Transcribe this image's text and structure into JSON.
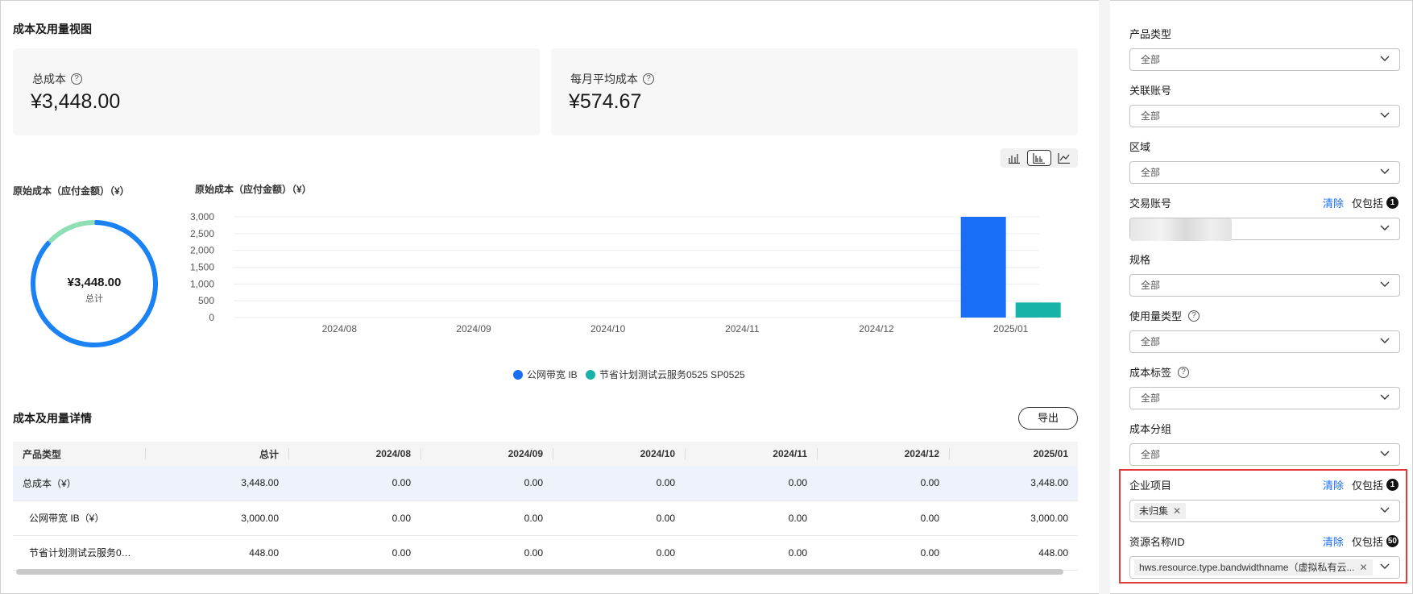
{
  "overview": {
    "title": "成本及用量视图",
    "total_cost_label": "总成本",
    "total_cost_value": "¥3,448.00",
    "monthly_avg_label": "每月平均成本",
    "monthly_avg_value": "¥574.67"
  },
  "view_switch": {
    "options": [
      "stacked-bar-icon",
      "grouped-bar-icon",
      "line-chart-icon"
    ],
    "active": 1
  },
  "ring": {
    "title": "原始成本（应付金额）（¥）",
    "center_value": "¥3,448.00",
    "center_label": "总计"
  },
  "chart_data": {
    "type": "bar",
    "title": "原始成本（应付金额）（¥）",
    "categories": [
      "2024/08",
      "2024/09",
      "2024/10",
      "2024/11",
      "2024/12",
      "2025/01"
    ],
    "series": [
      {
        "name": "公网带宽 IB",
        "color": "#1a6ef5",
        "values": [
          0,
          0,
          0,
          0,
          0,
          3000
        ]
      },
      {
        "name": "节省计划测试云服务0525 SP0525",
        "color": "#17b3a9",
        "values": [
          0,
          0,
          0,
          0,
          0,
          448
        ]
      }
    ],
    "yticks": [
      "0",
      "500",
      "1,000",
      "1,500",
      "2,000",
      "2,500",
      "3,000"
    ],
    "ylim": [
      0,
      3000
    ],
    "grid": true,
    "legend": "bottom"
  },
  "detail": {
    "title": "成本及用量详情",
    "export_label": "导出",
    "columns": [
      "产品类型",
      "总计",
      "2024/08",
      "2024/09",
      "2024/10",
      "2024/11",
      "2024/12",
      "2025/01"
    ],
    "rows": [
      [
        "总成本（¥）",
        "3,448.00",
        "0.00",
        "0.00",
        "0.00",
        "0.00",
        "0.00",
        "3,448.00"
      ],
      [
        "公网带宽 IB（¥）",
        "3,000.00",
        "0.00",
        "0.00",
        "0.00",
        "0.00",
        "0.00",
        "3,000.00"
      ],
      [
        "节省计划测试云服务0…",
        "448.00",
        "0.00",
        "0.00",
        "0.00",
        "0.00",
        "0.00",
        "448.00"
      ]
    ]
  },
  "filters": {
    "product_type": {
      "label": "产品类型",
      "value": "全部"
    },
    "linked_account": {
      "label": "关联账号",
      "value": "全部"
    },
    "region": {
      "label": "区域",
      "value": "全部"
    },
    "trade_account": {
      "label": "交易账号",
      "clear": "清除",
      "include": "仅包括",
      "count": "1"
    },
    "spec": {
      "label": "规格",
      "value": "全部"
    },
    "usage_type": {
      "label": "使用量类型",
      "value": "全部"
    },
    "cost_tag": {
      "label": "成本标签",
      "value": "全部"
    },
    "cost_group": {
      "label": "成本分组",
      "value": "全部"
    },
    "enterprise_project": {
      "label": "企业项目",
      "clear": "清除",
      "include": "仅包括",
      "count": "1",
      "tag": "未归集"
    },
    "resource": {
      "label": "资源名称/ID",
      "clear": "清除",
      "include": "仅包括",
      "count": "50",
      "tag": "hws.resource.type.bandwidthname（虚拟私有云..."
    }
  }
}
